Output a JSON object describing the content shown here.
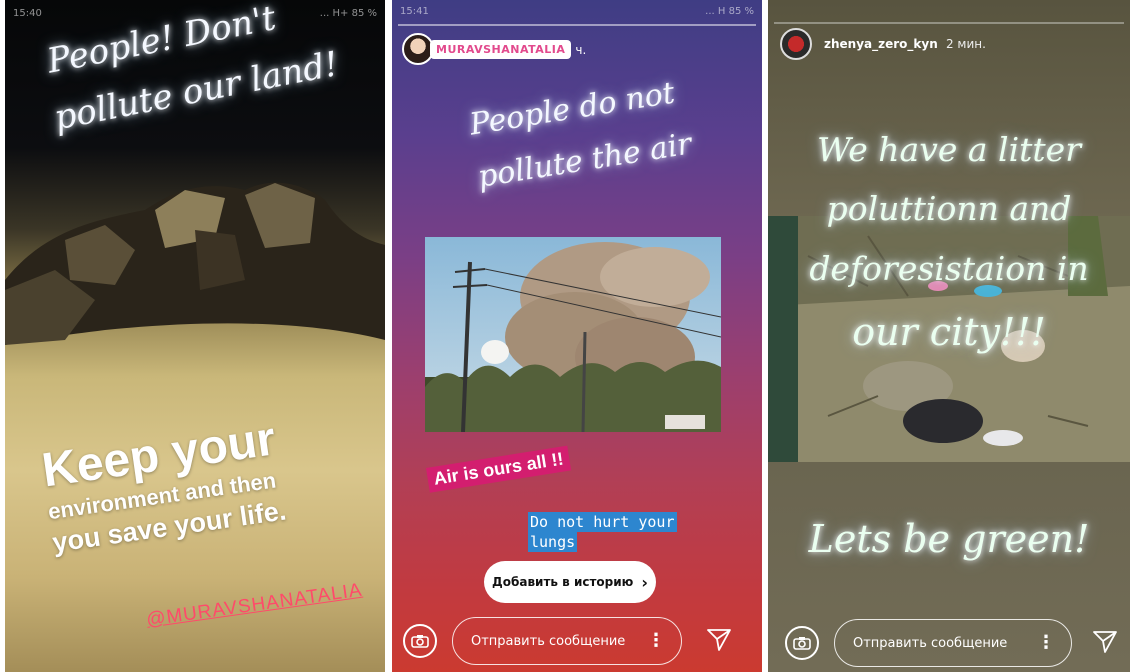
{
  "story1": {
    "time": "15:40",
    "status": "... H+ 85 %",
    "headline_line1": "People! Don't",
    "headline_line2": "pollute our land!",
    "big_line1": "Keep your",
    "big_line2": "environment and then",
    "big_line3": "you save your life.",
    "mention": "@MURAVSHANATALIA"
  },
  "story2": {
    "time": "15:41",
    "status": "... H 85 %",
    "username": "MURAVSHANATALIA",
    "age": "ч.",
    "headline_line1": "People do not",
    "headline_line2": "pollute the air",
    "sticker_red": "Air is ours all !!",
    "typewriter_line1": "Do not hurt your",
    "typewriter_line2": "lungs",
    "add_story_button": "Добавить в историю",
    "message_placeholder": "Отправить сообщение"
  },
  "story3": {
    "username": "zhenya_zero_kyn",
    "age": "2 мин.",
    "line1": "We have a litter",
    "line2": "poluttionn and",
    "line3": "deforesistaion in",
    "line4": "our city!!!",
    "bottom": "Lets be green!",
    "message_placeholder": "Отправить сообщение"
  },
  "icons": {
    "camera": "camera-icon",
    "more": "more-vertical-icon",
    "send": "send-icon",
    "chevron": "chevron-right-icon"
  }
}
